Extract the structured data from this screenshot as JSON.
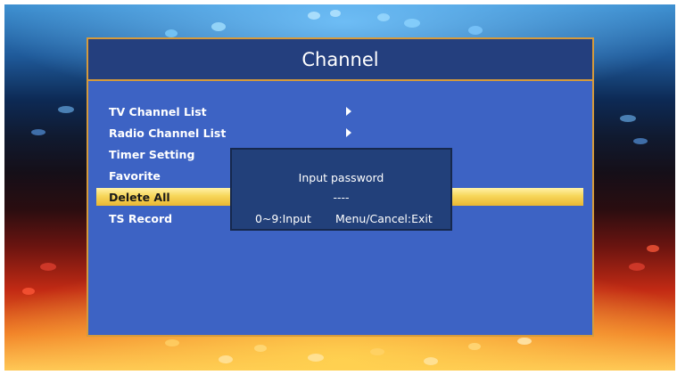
{
  "window": {
    "title": "Channel"
  },
  "menu": {
    "items": [
      {
        "label": "TV Channel List",
        "has_submenu": true
      },
      {
        "label": "Radio Channel List",
        "has_submenu": true
      },
      {
        "label": "Timer Setting",
        "has_submenu": false
      },
      {
        "label": "Favorite",
        "has_submenu": false
      },
      {
        "label": "Delete All",
        "has_submenu": false,
        "selected": true
      },
      {
        "label": "TS Record",
        "has_submenu": false
      }
    ]
  },
  "dialog": {
    "prompt": "Input password",
    "password_value": "----",
    "hint_input": "0~9:Input",
    "hint_exit": "Menu/Cancel:Exit"
  },
  "colors": {
    "panel_bg": "#3d63c4",
    "title_bar_bg": "#243f7e",
    "border_accent": "#d59a3c",
    "selected_highlight": "#f7d65a",
    "dialog_bg": "#22407a"
  },
  "icons": {
    "submenu_arrow": "triangle-right-icon"
  }
}
